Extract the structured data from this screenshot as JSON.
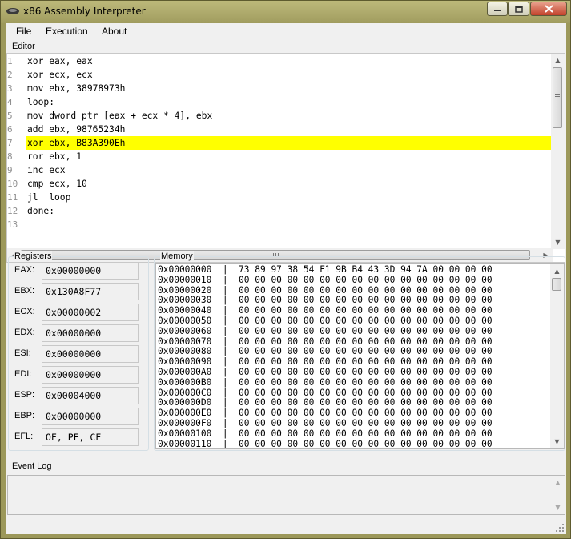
{
  "window": {
    "title": "x86 Assembly Interpreter"
  },
  "menu": {
    "file": "File",
    "execution": "Execution",
    "about": "About"
  },
  "editor": {
    "label": "Editor",
    "lines": [
      {
        "n": "1",
        "code": "xor eax, eax"
      },
      {
        "n": "2",
        "code": "xor ecx, ecx"
      },
      {
        "n": "3",
        "code": "mov ebx, 38978973h"
      },
      {
        "n": "4",
        "code": "loop:"
      },
      {
        "n": "5",
        "code": "mov dword ptr [eax + ecx * 4], ebx"
      },
      {
        "n": "6",
        "code": "add ebx, 98765234h"
      },
      {
        "n": "7",
        "code": "xor ebx, B83A390Eh"
      },
      {
        "n": "8",
        "code": "ror ebx, 1"
      },
      {
        "n": "9",
        "code": "inc ecx"
      },
      {
        "n": "10",
        "code": "cmp ecx, 10"
      },
      {
        "n": "11",
        "code": "jl  loop"
      },
      {
        "n": "12",
        "code": "done:"
      },
      {
        "n": "13",
        "code": ""
      }
    ],
    "highlighted_line": "7",
    "highlight_color": "#ffff00"
  },
  "registers": {
    "label": "Registers",
    "items": [
      {
        "name": "EAX:",
        "value": "0x00000000"
      },
      {
        "name": "EBX:",
        "value": "0x130A8F77"
      },
      {
        "name": "ECX:",
        "value": "0x00000002"
      },
      {
        "name": "EDX:",
        "value": "0x00000000"
      },
      {
        "name": "ESI:",
        "value": "0x00000000"
      },
      {
        "name": "EDI:",
        "value": "0x00000000"
      },
      {
        "name": "ESP:",
        "value": "0x00004000"
      },
      {
        "name": "EBP:",
        "value": "0x00000000"
      },
      {
        "name": "EFL:",
        "value": "OF, PF, CF"
      }
    ]
  },
  "memory": {
    "label": "Memory",
    "rows": [
      "0x00000000  |  73 89 97 38 54 F1 9B B4 43 3D 94 7A 00 00 00 00",
      "0x00000010  |  00 00 00 00 00 00 00 00 00 00 00 00 00 00 00 00",
      "0x00000020  |  00 00 00 00 00 00 00 00 00 00 00 00 00 00 00 00",
      "0x00000030  |  00 00 00 00 00 00 00 00 00 00 00 00 00 00 00 00",
      "0x00000040  |  00 00 00 00 00 00 00 00 00 00 00 00 00 00 00 00",
      "0x00000050  |  00 00 00 00 00 00 00 00 00 00 00 00 00 00 00 00",
      "0x00000060  |  00 00 00 00 00 00 00 00 00 00 00 00 00 00 00 00",
      "0x00000070  |  00 00 00 00 00 00 00 00 00 00 00 00 00 00 00 00",
      "0x00000080  |  00 00 00 00 00 00 00 00 00 00 00 00 00 00 00 00",
      "0x00000090  |  00 00 00 00 00 00 00 00 00 00 00 00 00 00 00 00",
      "0x000000A0  |  00 00 00 00 00 00 00 00 00 00 00 00 00 00 00 00",
      "0x000000B0  |  00 00 00 00 00 00 00 00 00 00 00 00 00 00 00 00",
      "0x000000C0  |  00 00 00 00 00 00 00 00 00 00 00 00 00 00 00 00",
      "0x000000D0  |  00 00 00 00 00 00 00 00 00 00 00 00 00 00 00 00",
      "0x000000E0  |  00 00 00 00 00 00 00 00 00 00 00 00 00 00 00 00",
      "0x000000F0  |  00 00 00 00 00 00 00 00 00 00 00 00 00 00 00 00",
      "0x00000100  |  00 00 00 00 00 00 00 00 00 00 00 00 00 00 00 00",
      "0x00000110  |  00 00 00 00 00 00 00 00 00 00 00 00 00 00 00 00"
    ]
  },
  "event_log": {
    "label": "Event Log"
  },
  "icons": {
    "app": "app-icon",
    "minimize": "minimize-icon",
    "maximize": "maximize-icon",
    "close": "close-icon",
    "scroll_up": "scroll-up-arrow-icon",
    "scroll_down": "scroll-down-arrow-icon",
    "scroll_left": "scroll-left-arrow-icon",
    "scroll_right": "scroll-right-arrow-icon"
  },
  "colors": {
    "titlebar": "#a9a566",
    "close_button": "#c2412a"
  }
}
